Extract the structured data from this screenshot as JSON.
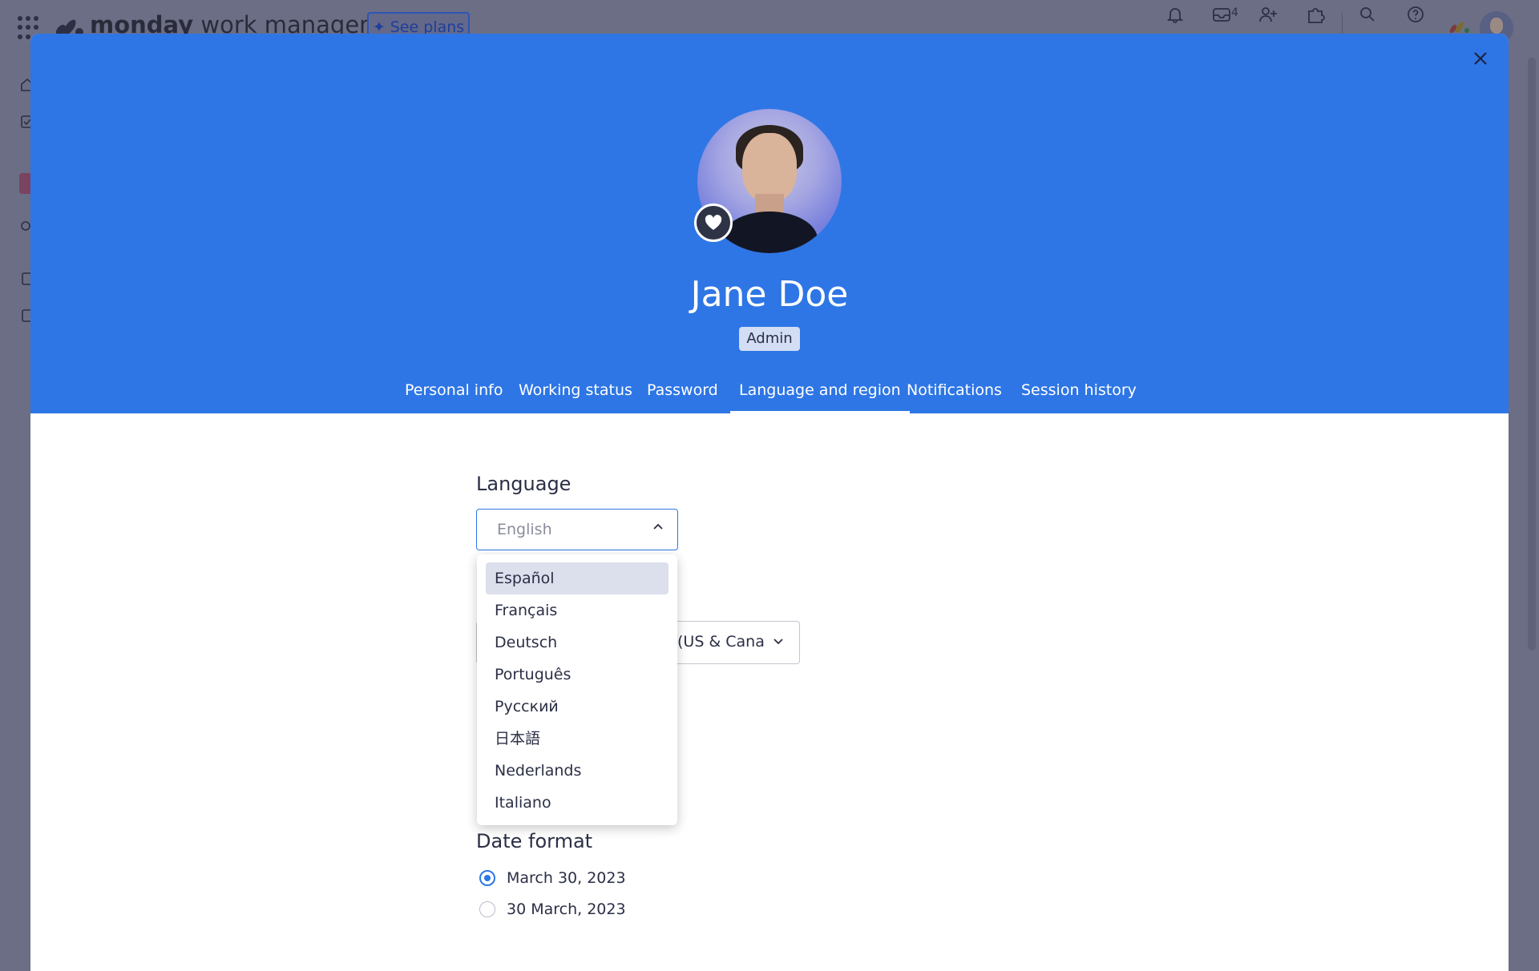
{
  "app": {
    "brand_bold": "monday",
    "brand_light": " work management",
    "see_plans": "See plans",
    "notification_count": "4"
  },
  "profile": {
    "name": "Jane Doe",
    "role": "Admin"
  },
  "tabs": [
    {
      "label": "Personal info"
    },
    {
      "label": "Working status"
    },
    {
      "label": "Password"
    },
    {
      "label": "Language and region"
    },
    {
      "label": "Notifications"
    },
    {
      "label": "Session history"
    }
  ],
  "language": {
    "label": "Language",
    "value": "English",
    "options": [
      "Español",
      "Français",
      "Deutsch",
      "Português",
      "Русский",
      "日本語",
      "Nederlands",
      "Italiano"
    ],
    "highlighted": "Español"
  },
  "timezone": {
    "visible_value": "(US & Canac"
  },
  "date_format": {
    "label": "Date format",
    "options": [
      {
        "label": "March 30, 2023",
        "selected": true
      },
      {
        "label": "30 March, 2023",
        "selected": false
      }
    ]
  },
  "colors": {
    "header_blue": "#2e76e5",
    "overlay": "#6b6e84",
    "text_dark": "#2b2f45",
    "dropdown_highlight": "#dcdfec"
  }
}
